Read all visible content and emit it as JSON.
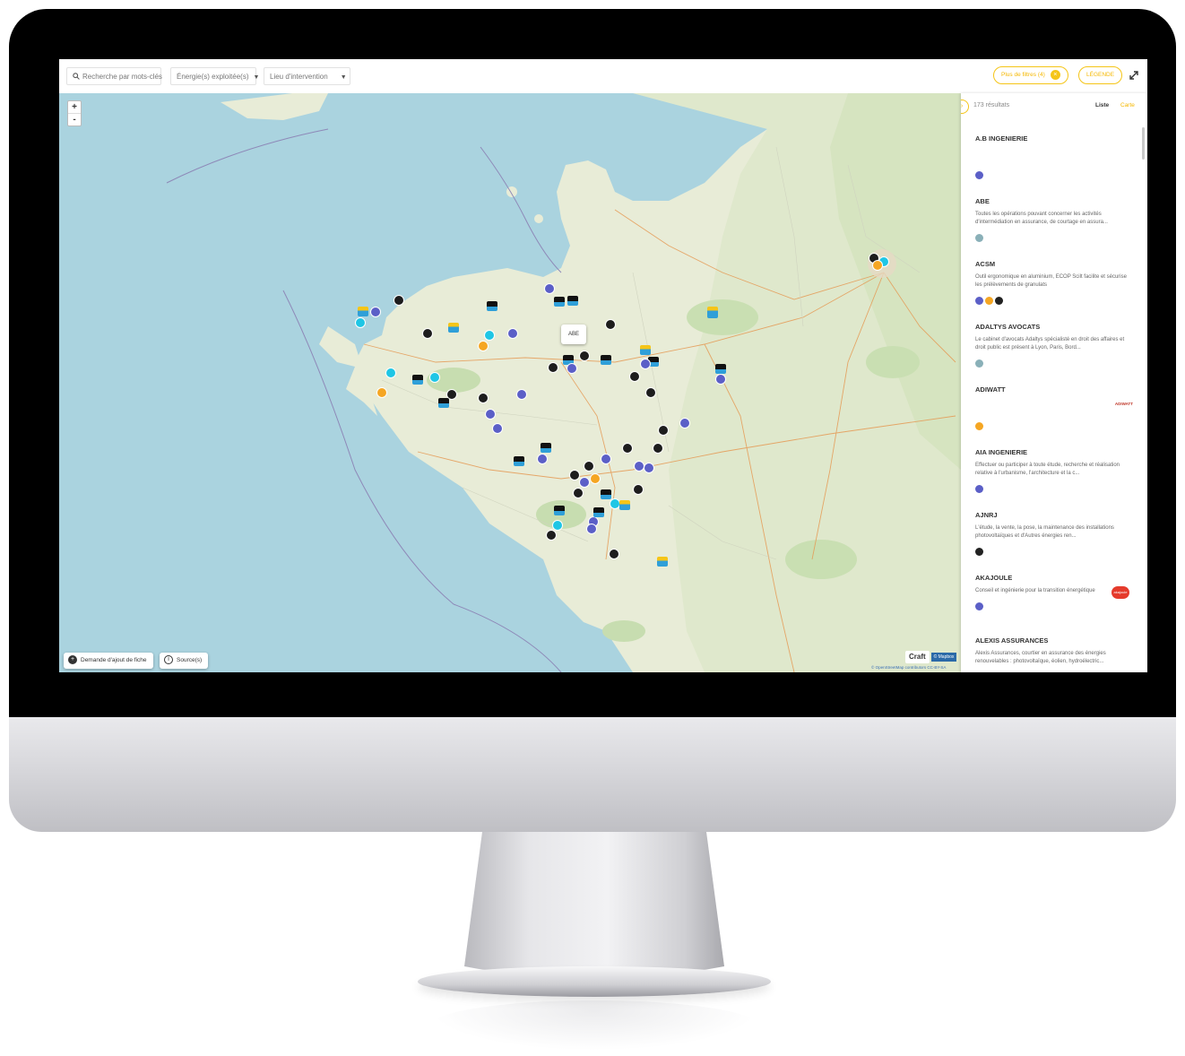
{
  "toolbar": {
    "search_placeholder": "Recherche par mots-clés",
    "energy_filter_label": "Énergie(s) exploitée(s)",
    "location_filter_label": "Lieu d'intervention",
    "filters_pill_label": "Plus de filtres (4)",
    "legend_pill_label": "LÉGENDE"
  },
  "map": {
    "zoom_in": "+",
    "zoom_out": "-",
    "tooltip": "ABE",
    "add_sheet_button": "Demande d'ajout de fiche",
    "sources_button": "Source(s)",
    "craft_logo": "Craft",
    "mapbox_logo": "© Mapbox",
    "attribution": "© OpenStreetMap contributors CC-BY-SA",
    "marker_colors": {
      "black": "#1d1d1d",
      "purple": "#5b5fc7",
      "cyan": "#1fc6e5",
      "orange": "#f5a623"
    }
  },
  "panel": {
    "results_count": "173 résultats",
    "view_list": "Liste",
    "view_map": "Carte",
    "entries": [
      {
        "name": "A.B INGENIERIE",
        "description": "",
        "logo": "",
        "icons": [
          "purple"
        ]
      },
      {
        "name": "ABE",
        "description": "Toutes les opérations pouvant concerner les activités d'intermédiation en assurance, de courtage en assura...",
        "logo": "",
        "icons": [
          "grey"
        ]
      },
      {
        "name": "ACSM",
        "description": "Outil ergonomique en aluminium, ECOP Scilt facilite et sécurise les prélèvements de granulats",
        "logo": "",
        "icons": [
          "purple",
          "orange",
          "black"
        ]
      },
      {
        "name": "ADALTYS AVOCATS",
        "description": "Le cabinet d'avocats Adaltys spécialisté en droit des affaires et droit public est présent à Lyon, Paris, Bord...",
        "logo": "",
        "icons": [
          "grey"
        ]
      },
      {
        "name": "ADIWATT",
        "description": "",
        "logo": "ADIWATT",
        "icons": [
          "orange"
        ]
      },
      {
        "name": "AIA INGENIERIE",
        "description": "Effectuer ou participer à toute étude, recherche et réalisation relative à l'urbanisme, l'architecture et la c...",
        "logo": "",
        "icons": [
          "purple"
        ]
      },
      {
        "name": "AJNRJ",
        "description": "L'étude, la vente, la pose, la maintenance des installations photovoltaïques et d'Autres énergies ren...",
        "logo": "",
        "icons": [
          "black"
        ]
      },
      {
        "name": "AKAJOULE",
        "description": "Conseil et ingénierie pour la transition énergétique",
        "logo": "akajoule",
        "icons": [
          "purple"
        ]
      },
      {
        "name": "ALEXIS ASSURANCES",
        "description": "Alexis Assurances, courtier en assurance des énergies renouvelables : photovoltaïque, éolien, hydroélectric...",
        "logo": "",
        "icons": []
      }
    ]
  }
}
